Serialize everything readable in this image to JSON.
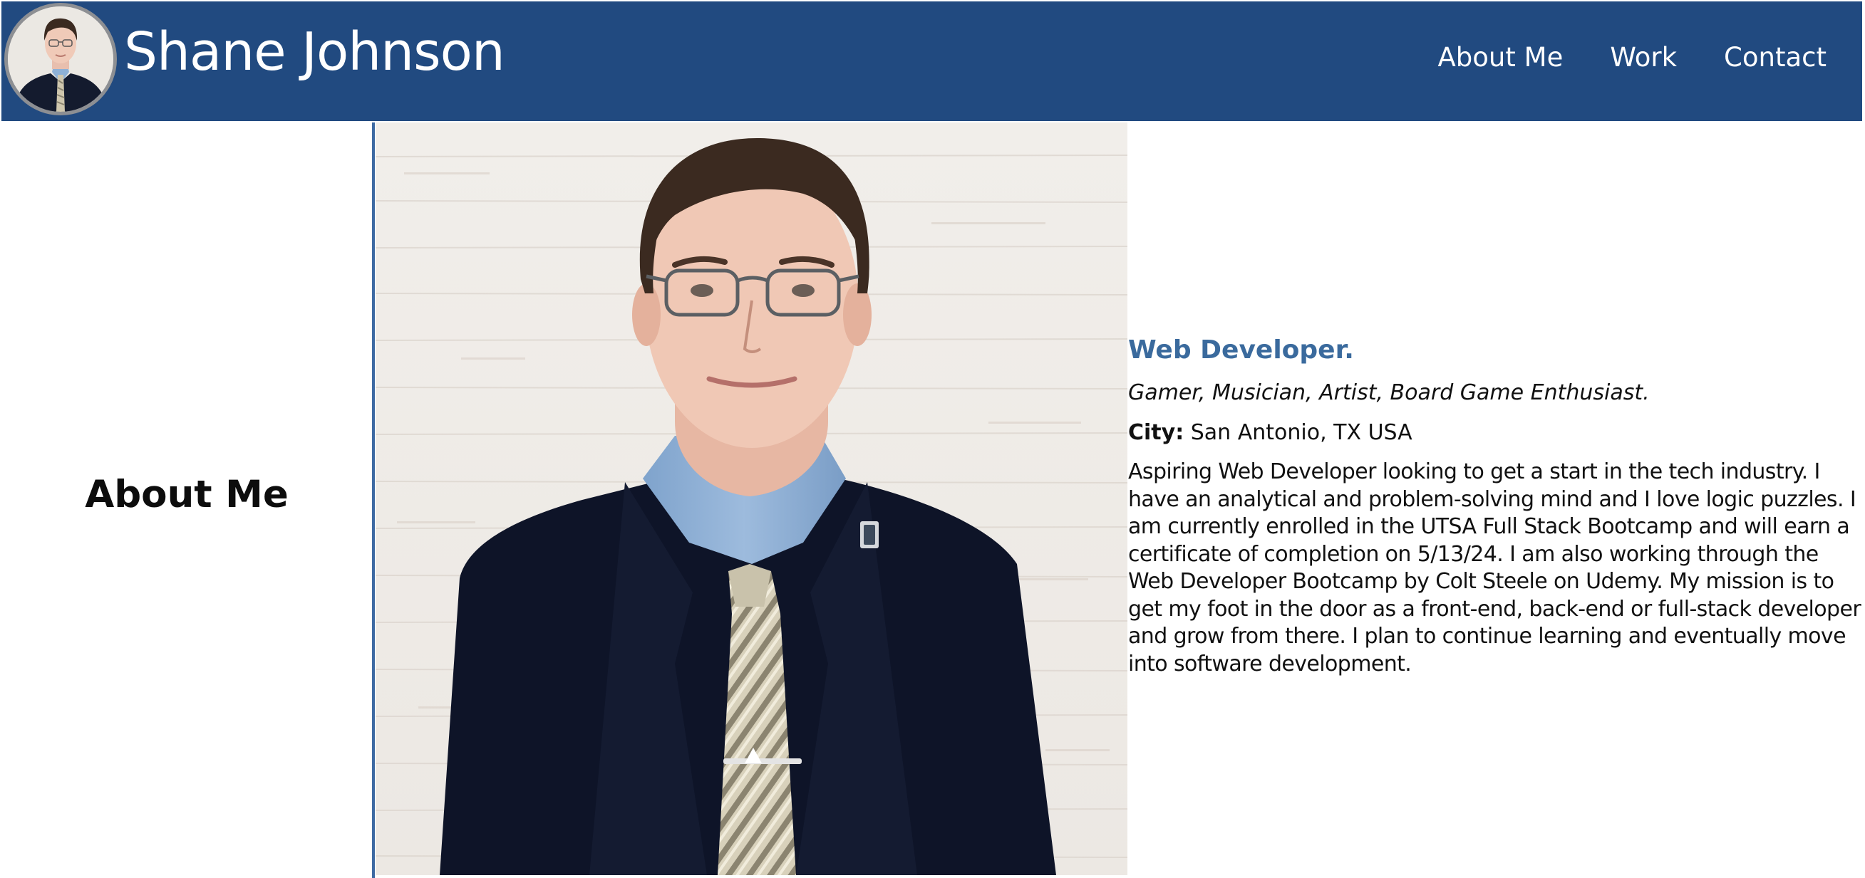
{
  "header": {
    "title": "Shane Johnson",
    "avatar_icon": "profile-photo",
    "background_color": "#214a80",
    "nav": {
      "about": "About Me",
      "work": "Work",
      "contact": "Contact"
    }
  },
  "about": {
    "heading": "About Me",
    "divider_color": "#3e6aa3",
    "portrait_icon": "portrait-photo",
    "role": "Web Developer.",
    "role_color": "#3a6a9d",
    "hobbies": "Gamer, Musician, Artist, Board Game Enthusiast.",
    "city_label": "City:",
    "city_value": "San Antonio, TX USA",
    "bio": "Aspiring Web Developer looking to get a start in the tech industry. I have an analytical and problem-solving mind and I love logic puzzles. I am currently enrolled in the UTSA Full Stack Bootcamp and will earn a certificate of completion on 5/13/24. I am also working through the Web Developer Bootcamp by Colt Steele on Udemy. My mission is to get my foot in the door as a front-end, back-end or full-stack developer and grow from there. I plan to continue learning and eventually move into software development."
  }
}
